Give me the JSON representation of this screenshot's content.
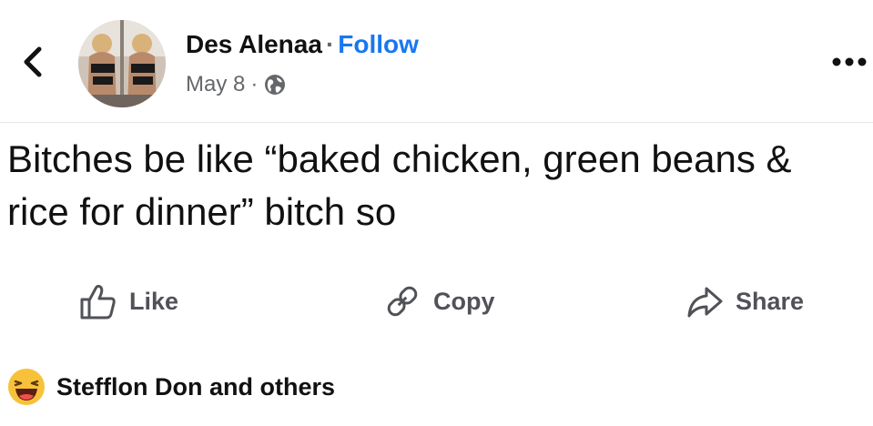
{
  "post": {
    "author": "Des Alenaa",
    "separator": "·",
    "follow_label": "Follow",
    "date": "May 8",
    "audience_icon": "globe-icon",
    "text": "Bitches be like “baked chicken, green beans & rice for dinner” bitch so"
  },
  "actions": {
    "like_label": "Like",
    "copy_label": "Copy",
    "share_label": "Share"
  },
  "reactions": {
    "emoji_icon": "laughing-emoji-icon",
    "summary": "Stefflon Don and others"
  },
  "icons": {
    "back": "chevron-left-icon",
    "more": "more-horizontal-icon",
    "like": "thumbs-up-icon",
    "copy": "link-icon",
    "share": "share-arrow-icon"
  },
  "colors": {
    "link_blue": "#1877f2",
    "secondary_text": "#65676b",
    "action_text": "#505257"
  }
}
